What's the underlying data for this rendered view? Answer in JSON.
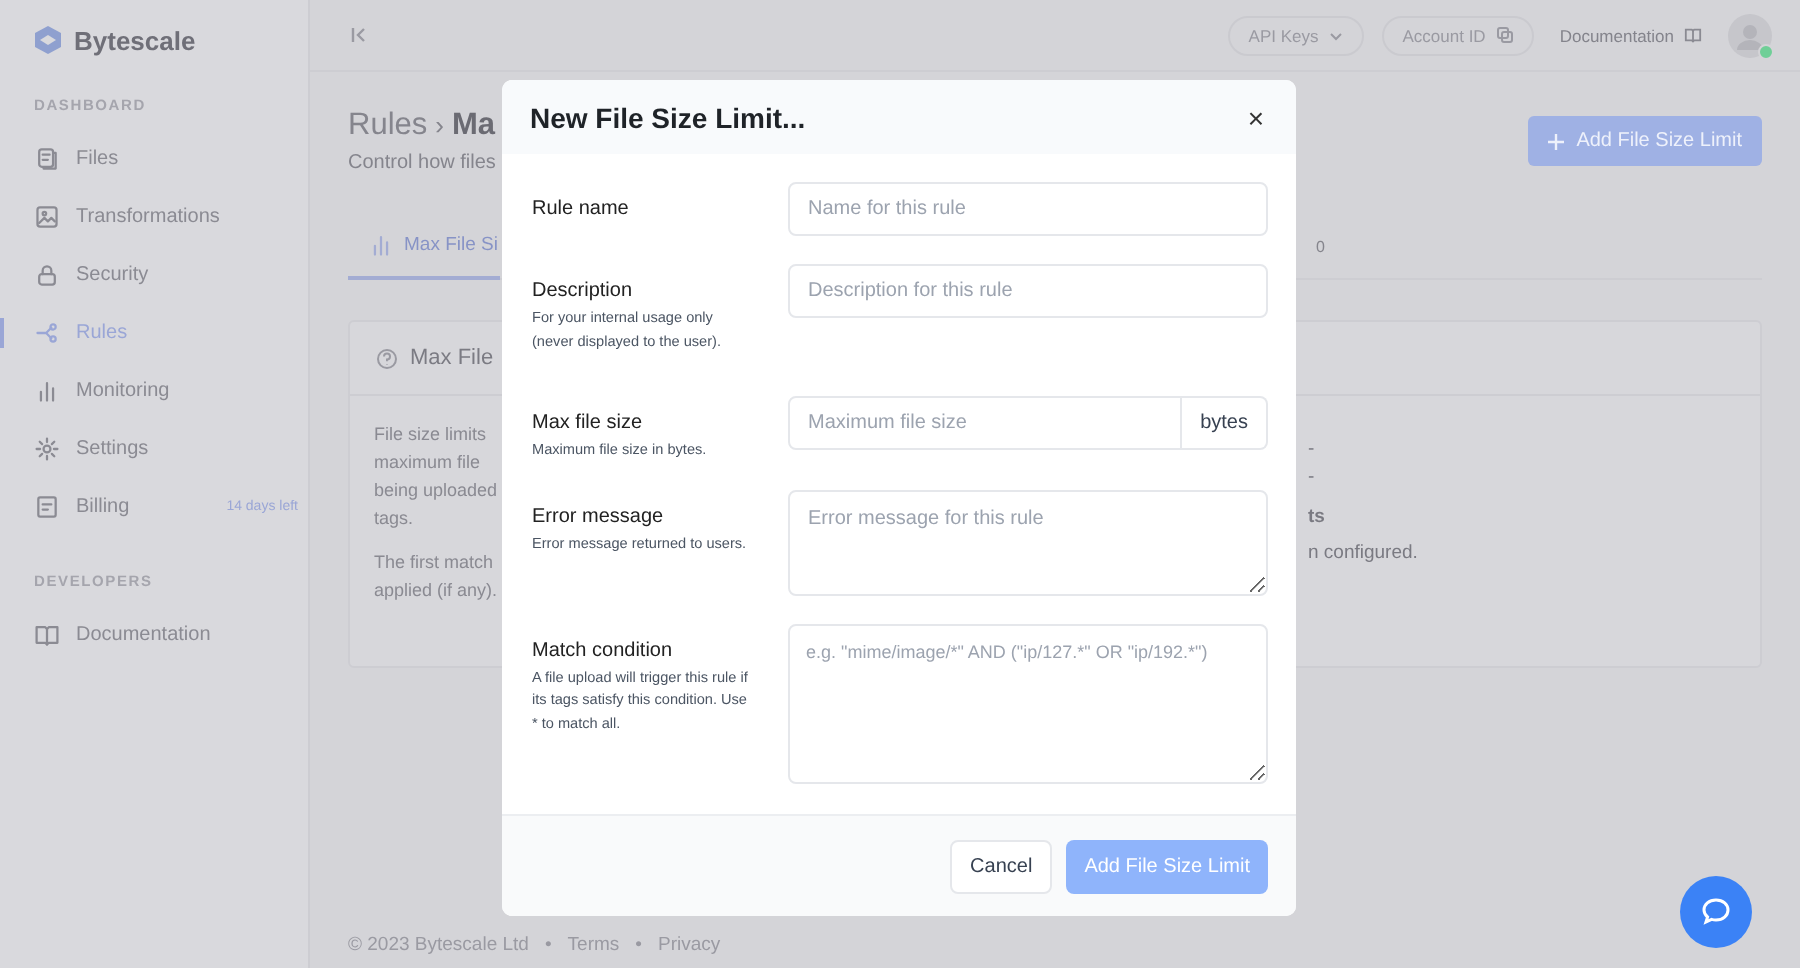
{
  "sidebar": {
    "brand": "Bytescale",
    "sections": [
      {
        "heading": "DASHBOARD",
        "items": [
          {
            "label": "Files",
            "selected": false
          },
          {
            "label": "Transformations",
            "selected": false
          },
          {
            "label": "Security",
            "selected": false
          },
          {
            "label": "Rules",
            "selected": true
          },
          {
            "label": "Monitoring",
            "selected": false
          },
          {
            "label": "Settings",
            "selected": false
          },
          {
            "label": "Billing",
            "selected": false,
            "badge": "14 days left"
          }
        ]
      },
      {
        "heading": "DEVELOPERS",
        "items": [
          {
            "label": "Documentation",
            "selected": false
          }
        ]
      }
    ]
  },
  "topbar": {
    "buttons": [
      {
        "label": "API Keys",
        "kind": "dropdown"
      },
      {
        "label": "Account ID",
        "kind": "copy"
      },
      {
        "label": "Documentation",
        "kind": "link"
      }
    ],
    "avatar_online": true
  },
  "page": {
    "breadcrumb": "Rules",
    "separator": "›",
    "title": "Ma",
    "subtitle": "Control how files",
    "primary_button": "Add File Size Limit",
    "tabs": [
      {
        "label": "Max File Si",
        "selected": true
      }
    ],
    "tab_fragment": "0"
  },
  "card": {
    "title": "Max File",
    "paragraphs": [
      [
        "File size limits",
        "maximum file",
        "being uploaded",
        "tags."
      ],
      [
        "The first match",
        "applied (if any)."
      ]
    ],
    "right_fragments": [
      "-",
      "-",
      "ts",
      "n configured."
    ]
  },
  "modal": {
    "title": "New File Size Limit...",
    "close": "×",
    "fields": [
      {
        "kind": "text",
        "label": "Rule name",
        "placeholder": "Name for this rule"
      },
      {
        "kind": "text",
        "label": "Description",
        "help": "For your internal usage only (never displayed to the user).",
        "placeholder": "Description for this rule"
      },
      {
        "kind": "addon",
        "label": "Max file size",
        "help": "Maximum file size in bytes.",
        "placeholder": "Maximum file size",
        "addon": "bytes"
      },
      {
        "kind": "textarea",
        "label": "Error message",
        "help": "Error message returned to users.",
        "placeholder": "Error message for this rule"
      },
      {
        "kind": "textarea_tall",
        "label": "Match condition",
        "help": "A file upload will trigger this rule if its tags satisfy this condition. Use * to match all.",
        "placeholder": "e.g. \"mime/image/*\" AND (\"ip/127.*\" OR \"ip/192.*\")"
      }
    ],
    "cancel": "Cancel",
    "submit": "Add File Size Limit"
  },
  "footer": {
    "copyright": "© 2023 Bytescale Ltd",
    "separator": "•",
    "links": [
      "Terms",
      "Privacy"
    ]
  }
}
